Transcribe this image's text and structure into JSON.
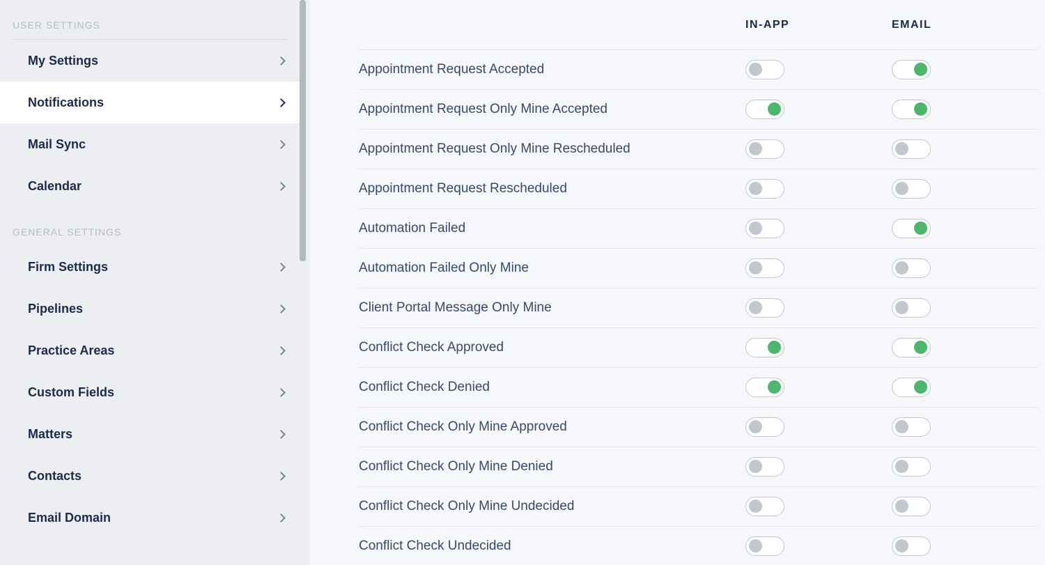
{
  "sidebar": {
    "sections": [
      {
        "title": "USER SETTINGS",
        "items": [
          {
            "label": "My Settings",
            "name": "nav-my-settings",
            "active": false
          },
          {
            "label": "Notifications",
            "name": "nav-notifications",
            "active": true
          },
          {
            "label": "Mail Sync",
            "name": "nav-mail-sync",
            "active": false
          },
          {
            "label": "Calendar",
            "name": "nav-calendar",
            "active": false
          }
        ]
      },
      {
        "title": "GENERAL SETTINGS",
        "items": [
          {
            "label": "Firm Settings",
            "name": "nav-firm-settings",
            "active": false
          },
          {
            "label": "Pipelines",
            "name": "nav-pipelines",
            "active": false
          },
          {
            "label": "Practice Areas",
            "name": "nav-practice-areas",
            "active": false
          },
          {
            "label": "Custom Fields",
            "name": "nav-custom-fields",
            "active": false
          },
          {
            "label": "Matters",
            "name": "nav-matters",
            "active": false
          },
          {
            "label": "Contacts",
            "name": "nav-contacts",
            "active": false
          },
          {
            "label": "Email Domain",
            "name": "nav-email-domain",
            "active": false
          }
        ]
      }
    ]
  },
  "table": {
    "headers": {
      "inapp": "IN-APP",
      "email": "EMAIL"
    },
    "rows": [
      {
        "label": "Appointment Request Accepted",
        "inapp": false,
        "email": true
      },
      {
        "label": "Appointment Request Only Mine Accepted",
        "inapp": true,
        "email": true
      },
      {
        "label": "Appointment Request Only Mine Rescheduled",
        "inapp": false,
        "email": false
      },
      {
        "label": "Appointment Request Rescheduled",
        "inapp": false,
        "email": false
      },
      {
        "label": "Automation Failed",
        "inapp": false,
        "email": true
      },
      {
        "label": "Automation Failed Only Mine",
        "inapp": false,
        "email": false
      },
      {
        "label": "Client Portal Message Only Mine",
        "inapp": false,
        "email": false
      },
      {
        "label": "Conflict Check Approved",
        "inapp": true,
        "email": true
      },
      {
        "label": "Conflict Check Denied",
        "inapp": true,
        "email": true
      },
      {
        "label": "Conflict Check Only Mine Approved",
        "inapp": false,
        "email": false
      },
      {
        "label": "Conflict Check Only Mine Denied",
        "inapp": false,
        "email": false
      },
      {
        "label": "Conflict Check Only Mine Undecided",
        "inapp": false,
        "email": false
      },
      {
        "label": "Conflict Check Undecided",
        "inapp": false,
        "email": false
      }
    ]
  }
}
